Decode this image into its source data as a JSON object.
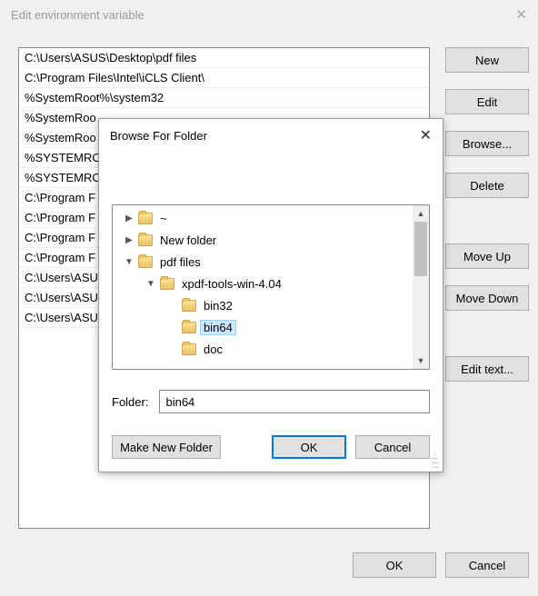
{
  "window": {
    "title": "Edit environment variable"
  },
  "list": {
    "items": [
      "C:\\Users\\ASUS\\Desktop\\pdf files",
      "C:\\Program Files\\Intel\\iCLS Client\\",
      "%SystemRoot%\\system32",
      "%SystemRoo",
      "%SystemRoo",
      "%SYSTEMRO",
      "%SYSTEMRO",
      "C:\\Program F",
      "C:\\Program F",
      "C:\\Program F",
      "C:\\Program F",
      "C:\\Users\\ASU",
      "C:\\Users\\ASU",
      "C:\\Users\\ASU"
    ]
  },
  "side": {
    "new": "New",
    "edit": "Edit",
    "browse": "Browse...",
    "delete": "Delete",
    "moveup": "Move Up",
    "movedown": "Move Down",
    "edittext": "Edit text..."
  },
  "bottom": {
    "ok": "OK",
    "cancel": "Cancel"
  },
  "dialog": {
    "title": "Browse For Folder",
    "folder_label": "Folder:",
    "folder_value": "bin64",
    "make_new": "Make New Folder",
    "ok": "OK",
    "cancel": "Cancel",
    "tree": [
      {
        "indent": 12,
        "expander": "▶",
        "label": "~"
      },
      {
        "indent": 12,
        "expander": "▶",
        "label": "New folder"
      },
      {
        "indent": 12,
        "expander": "▼",
        "label": "pdf files"
      },
      {
        "indent": 36,
        "expander": "▼",
        "label": "xpdf-tools-win-4.04"
      },
      {
        "indent": 60,
        "expander": "",
        "label": "bin32"
      },
      {
        "indent": 60,
        "expander": "",
        "label": "bin64",
        "selected": true
      },
      {
        "indent": 60,
        "expander": "",
        "label": "doc"
      }
    ]
  }
}
